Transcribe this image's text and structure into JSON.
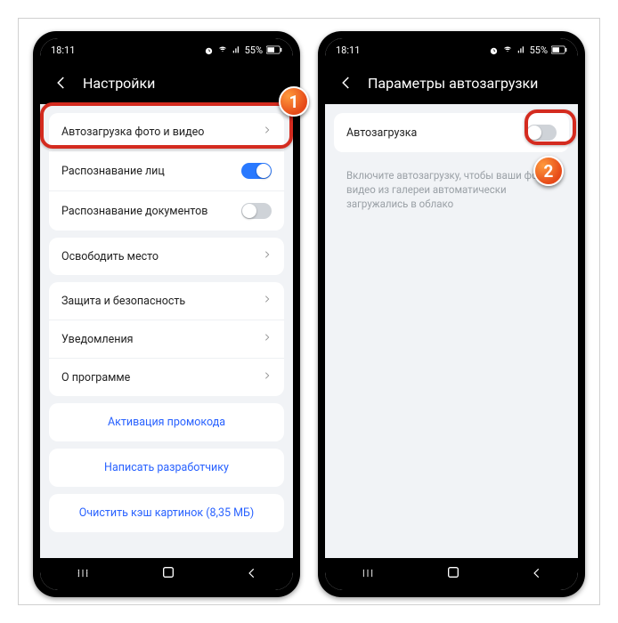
{
  "status": {
    "time": "18:11",
    "battery": "55%"
  },
  "badges": {
    "one": "1",
    "two": "2"
  },
  "left": {
    "title": "Настройки",
    "autoupload": "Автозагрузка фото и видео",
    "face": "Распознавание лиц",
    "docs": "Распознавание документов",
    "free": "Освободить место",
    "security": "Защита и безопасность",
    "notif": "Уведомления",
    "about": "О программе",
    "promo": "Активация промокода",
    "write": "Написать разработчику",
    "clear": "Очистить кэш картинок (8,35 МБ)"
  },
  "right": {
    "title": "Параметры автозагрузки",
    "row": "Автозагрузка",
    "hint": "Включите автозагрузку, чтобы ваши фото и видео из галереи автоматически загружались в облако"
  }
}
